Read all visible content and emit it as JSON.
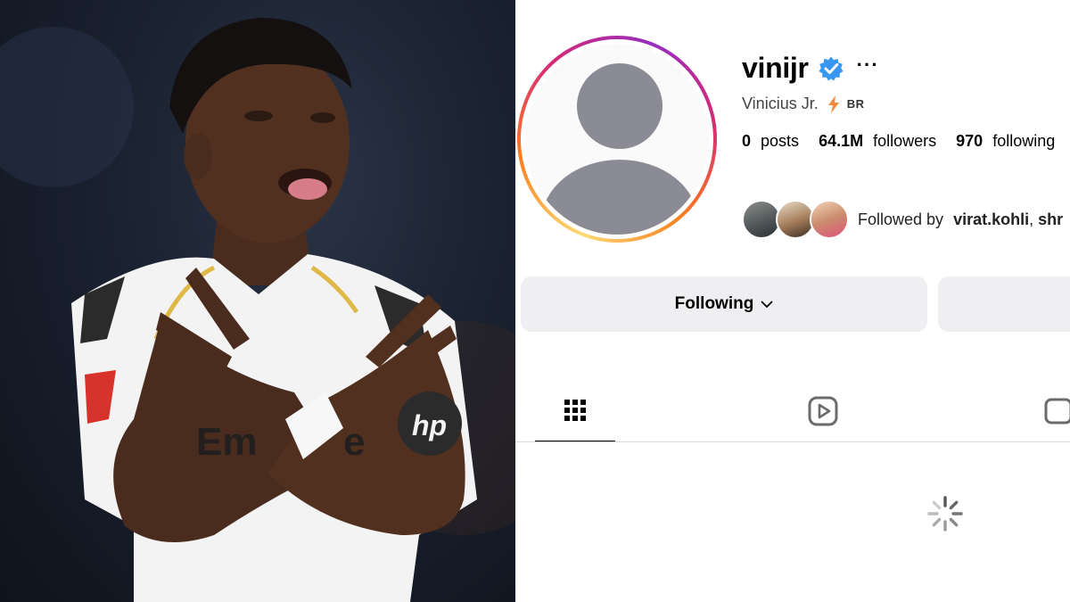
{
  "profile": {
    "username": "vinijr",
    "full_name": "Vinicius Jr.",
    "country_code": "BR",
    "stats": {
      "posts_count": "0",
      "posts_label": "posts",
      "followers_count": "64.1M",
      "followers_label": "followers",
      "following_count": "970",
      "following_label": "following"
    },
    "followed_by": {
      "prefix": "Followed by",
      "names": "virat.kohli",
      "separator": ", ",
      "more": "shr"
    }
  },
  "actions": {
    "following_label": "Following"
  },
  "tabs": [
    {
      "icon": "grid-icon",
      "active": true
    },
    {
      "icon": "reels-icon",
      "active": false
    },
    {
      "icon": "tagged-icon",
      "active": false
    }
  ],
  "colors": {
    "verified": "#3897f0",
    "button_bg": "#efeff2",
    "ring_start": "#feda75",
    "ring_mid": "#d62976",
    "ring_end": "#962fbf",
    "bolt": "#f58a3a"
  }
}
